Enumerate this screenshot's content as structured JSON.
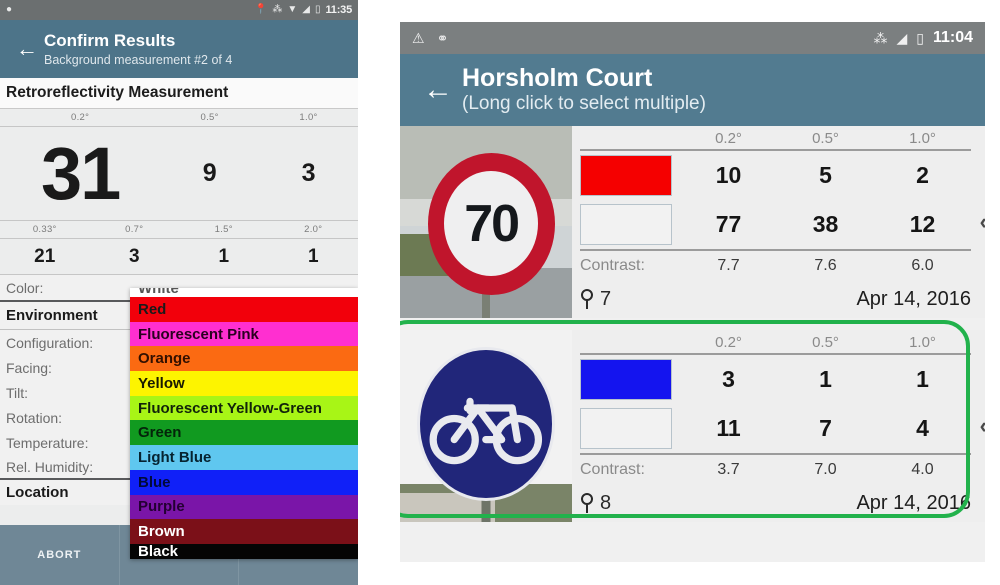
{
  "left_phone": {
    "status_bar": {
      "icons": [
        "location-icon",
        "bluetooth-icon",
        "wifi-icon",
        "signal-icon",
        "battery-icon"
      ],
      "time": "11:35"
    },
    "app_bar": {
      "back_icon": "←",
      "title": "Confirm Results",
      "subtitle": "Background measurement #2 of 4"
    },
    "section_title": "Retroreflectivity Measurement",
    "table": {
      "row1_headers": [
        "0.2°",
        "0.5°",
        "1.0°"
      ],
      "row1_values": [
        "31",
        "9",
        "3"
      ],
      "row2_headers": [
        "0.33°",
        "0.7°",
        "1.5°",
        "2.0°"
      ],
      "row2_values": [
        "21",
        "3",
        "1",
        "1"
      ]
    },
    "form": {
      "color_label": "Color:",
      "environment_header": "Environment",
      "fields": [
        "Configuration:",
        "Facing:",
        "Tilt:",
        "Rotation:",
        "Temperature:",
        "Rel. Humidity:"
      ],
      "location_header": "Location"
    },
    "color_dropdown": {
      "items": [
        {
          "label": "White",
          "bg": "#ffffff",
          "fg": "#555555"
        },
        {
          "label": "Red",
          "bg": "#f2000b",
          "fg": "#1a1a1a"
        },
        {
          "label": "Fluorescent Pink",
          "bg": "#ff2fd0",
          "fg": "#2a0020"
        },
        {
          "label": "Orange",
          "bg": "#fb6a12",
          "fg": "#331000"
        },
        {
          "label": "Yellow",
          "bg": "#fdf400",
          "fg": "#1a1a00"
        },
        {
          "label": "Fluorescent Yellow-Green",
          "bg": "#a8f516",
          "fg": "#12240a"
        },
        {
          "label": "Green",
          "bg": "#119a20",
          "fg": "#04240a"
        },
        {
          "label": "Light Blue",
          "bg": "#5fc7ef",
          "fg": "#062330"
        },
        {
          "label": "Blue",
          "bg": "#1020f8",
          "fg": "#000a3a"
        },
        {
          "label": "Purple",
          "bg": "#7a15a8",
          "fg": "#240033"
        },
        {
          "label": "Brown",
          "bg": "#7b1018",
          "fg": "#ffffff"
        },
        {
          "label": "Black",
          "bg": "#050505",
          "fg": "#ffffff"
        }
      ]
    },
    "bottom_bar": {
      "abort_label": "ABORT"
    }
  },
  "right_phone": {
    "status_bar": {
      "icons": [
        "warning-icon",
        "usb-icon",
        "bluetooth-icon",
        "signal-icon",
        "battery-icon"
      ],
      "time": "11:04"
    },
    "app_bar": {
      "back_icon": "←",
      "title": "Horsholm Court",
      "subtitle": "(Long click to select multiple)"
    },
    "angle_headers": [
      "0.2°",
      "0.5°",
      "1.0°"
    ],
    "contrast_label": "Contrast:",
    "chevron_icon": "‹",
    "cards": [
      {
        "thumb": "speed-limit-70-sign-photo",
        "thumb_sign_number": "70",
        "selected": false,
        "swatch_colors": [
          "#f50000",
          "#f2f2f2"
        ],
        "row_top_values": [
          "10",
          "5",
          "2"
        ],
        "row_bottom_values": [
          "77",
          "38",
          "12"
        ],
        "contrast_values": [
          "7.7",
          "7.6",
          "6.0"
        ],
        "pin_count": "7",
        "date": "Apr 14, 2016"
      },
      {
        "thumb": "bicycle-route-sign-photo",
        "thumb_sign_number": "",
        "selected": true,
        "swatch_colors": [
          "#1414ef",
          "#f2f2f2"
        ],
        "row_top_values": [
          "3",
          "1",
          "1"
        ],
        "row_bottom_values": [
          "11",
          "7",
          "4"
        ],
        "contrast_values": [
          "3.7",
          "7.0",
          "4.0"
        ],
        "pin_count": "8",
        "date": "Apr 14, 2016"
      }
    ],
    "selection_highlight_color": "#22b24c"
  }
}
